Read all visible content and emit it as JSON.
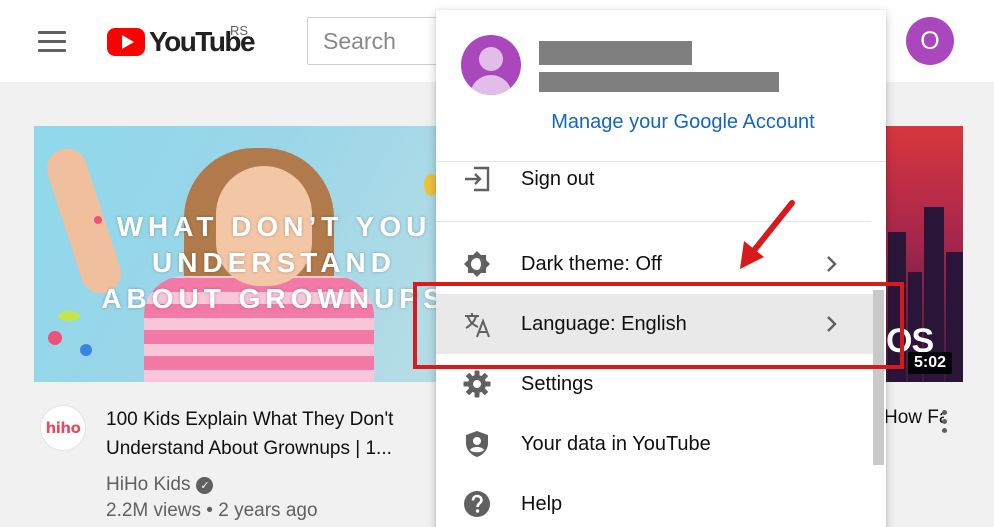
{
  "header": {
    "logo_text": "YouTube",
    "region": "RS",
    "search_placeholder": "Search",
    "avatar_letter": "O"
  },
  "feed": {
    "video1": {
      "thumbnail_text": [
        "WHAT DON’T YOU",
        "UNDERSTAND",
        "ABOUT GROWNUPS"
      ],
      "title_line1": "100 Kids Explain What They Don't",
      "title_line2": "Understand About Grownups | 1...",
      "channel": "HiHo Kids",
      "channel_logo_text": "hiho",
      "meta": "2.2M views • 2 years ago"
    },
    "video2": {
      "thumbnail_text": "OS",
      "duration": "5:02",
      "title": "How Facebook is Stealing Billions of"
    }
  },
  "account_menu": {
    "manage_account_label": "Manage your Google Account",
    "items": [
      {
        "label": "Sign out",
        "icon": "sign-out-icon"
      },
      {
        "label": "Dark theme: Off",
        "icon": "dark-theme-icon"
      },
      {
        "label": "Language: English",
        "icon": "language-icon"
      },
      {
        "label": "Settings",
        "icon": "gear-icon"
      },
      {
        "label": "Your data in YouTube",
        "icon": "shield-user-icon"
      },
      {
        "label": "Help",
        "icon": "help-icon"
      }
    ]
  },
  "colors": {
    "accent_red": "#ff0000",
    "avatar_purple": "#ab47bc",
    "link_blue": "#1565c0",
    "annotation_red": "#d51b1b"
  }
}
